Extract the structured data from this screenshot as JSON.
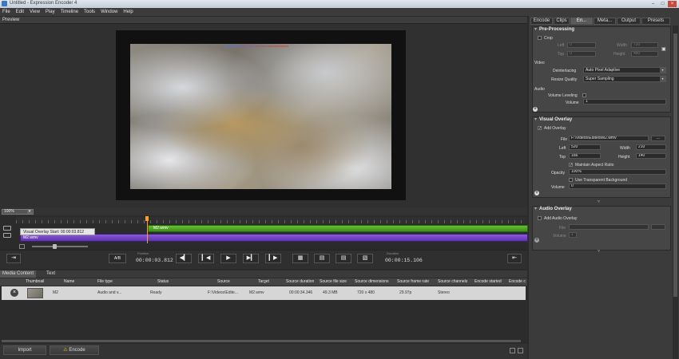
{
  "window": {
    "title": "Untitled - Expression Encoder 4"
  },
  "menu": [
    "File",
    "Edit",
    "View",
    "Play",
    "Timeline",
    "Tools",
    "Window",
    "Help"
  ],
  "preview": {
    "title": "Preview"
  },
  "timeline": {
    "zoom": "100%",
    "overlay_clip": "M2.wmv",
    "overlay_tooltip": "Visual Overlay Start: 00:00:03.812",
    "main_clip": "M2.wmv"
  },
  "transport": {
    "ab_label": "A/B",
    "position_label": "Position",
    "position": "00:00:03.812",
    "duration_label": "Duration",
    "duration": "00:00:15.106"
  },
  "media": {
    "tabs": [
      "Media Content",
      "Text"
    ],
    "columns": [
      "Thumbnail",
      "Name",
      "File type",
      "Status",
      "Source",
      "Target",
      "Source duration",
      "Source file size",
      "Source dimensions",
      "Source frame rate",
      "Source channels",
      "Encode started",
      "Encode c"
    ],
    "row": {
      "name": "M2",
      "file_type": "Audio and v...",
      "status": "Ready",
      "source": "F:\\Videos\\Edite...",
      "target": "M2.wmv",
      "duration": "00:00:34.346",
      "size": "49.3 MB",
      "dimensions": "720 x 480",
      "frame_rate": "29.97p",
      "channels": "Stereo"
    }
  },
  "bottom": {
    "import": "Import",
    "encode": "Encode"
  },
  "right": {
    "tabs": [
      "Encode",
      "Clips",
      "En...",
      "Meta...",
      "Output",
      "Presets"
    ],
    "preprocessing": {
      "title": "Pre-Processing",
      "crop": "Crop",
      "left_label": "Left",
      "left": "0",
      "width_label": "Width",
      "width": "720",
      "top_label": "Top",
      "top": "0",
      "height_label": "Height",
      "height": "480"
    },
    "video": {
      "title": "Video",
      "deinterlacing_label": "Deinterlacing",
      "deinterlacing": "Auto Pixel Adaptive",
      "resize_label": "Resize Quality",
      "resize": "Super Sampling"
    },
    "audio": {
      "title": "Audio",
      "leveling": "Volume Leveling",
      "volume_label": "Volume",
      "volume": "1"
    },
    "visual_overlay": {
      "title": "Visual Overlay",
      "add": "Add Overlay",
      "file_label": "File",
      "file": "F:\\Videos\\Edited\\M2.wmv",
      "browse": "...",
      "left_label": "Left",
      "left": "520",
      "width_label": "Width",
      "width": "210",
      "top_label": "Top",
      "top": "166",
      "height_label": "Height",
      "height": "140",
      "aspect": "Maintain Aspect Ratio",
      "opacity_label": "Opacity",
      "opacity": "100%",
      "transparent": "Use Transparent Background",
      "volume_label": "Volume",
      "volume": "0"
    },
    "audio_overlay": {
      "title": "Audio Overlay",
      "add": "Add Audio Overlay",
      "file_label": "File",
      "volume_label": "Volume",
      "volume": "1"
    }
  }
}
